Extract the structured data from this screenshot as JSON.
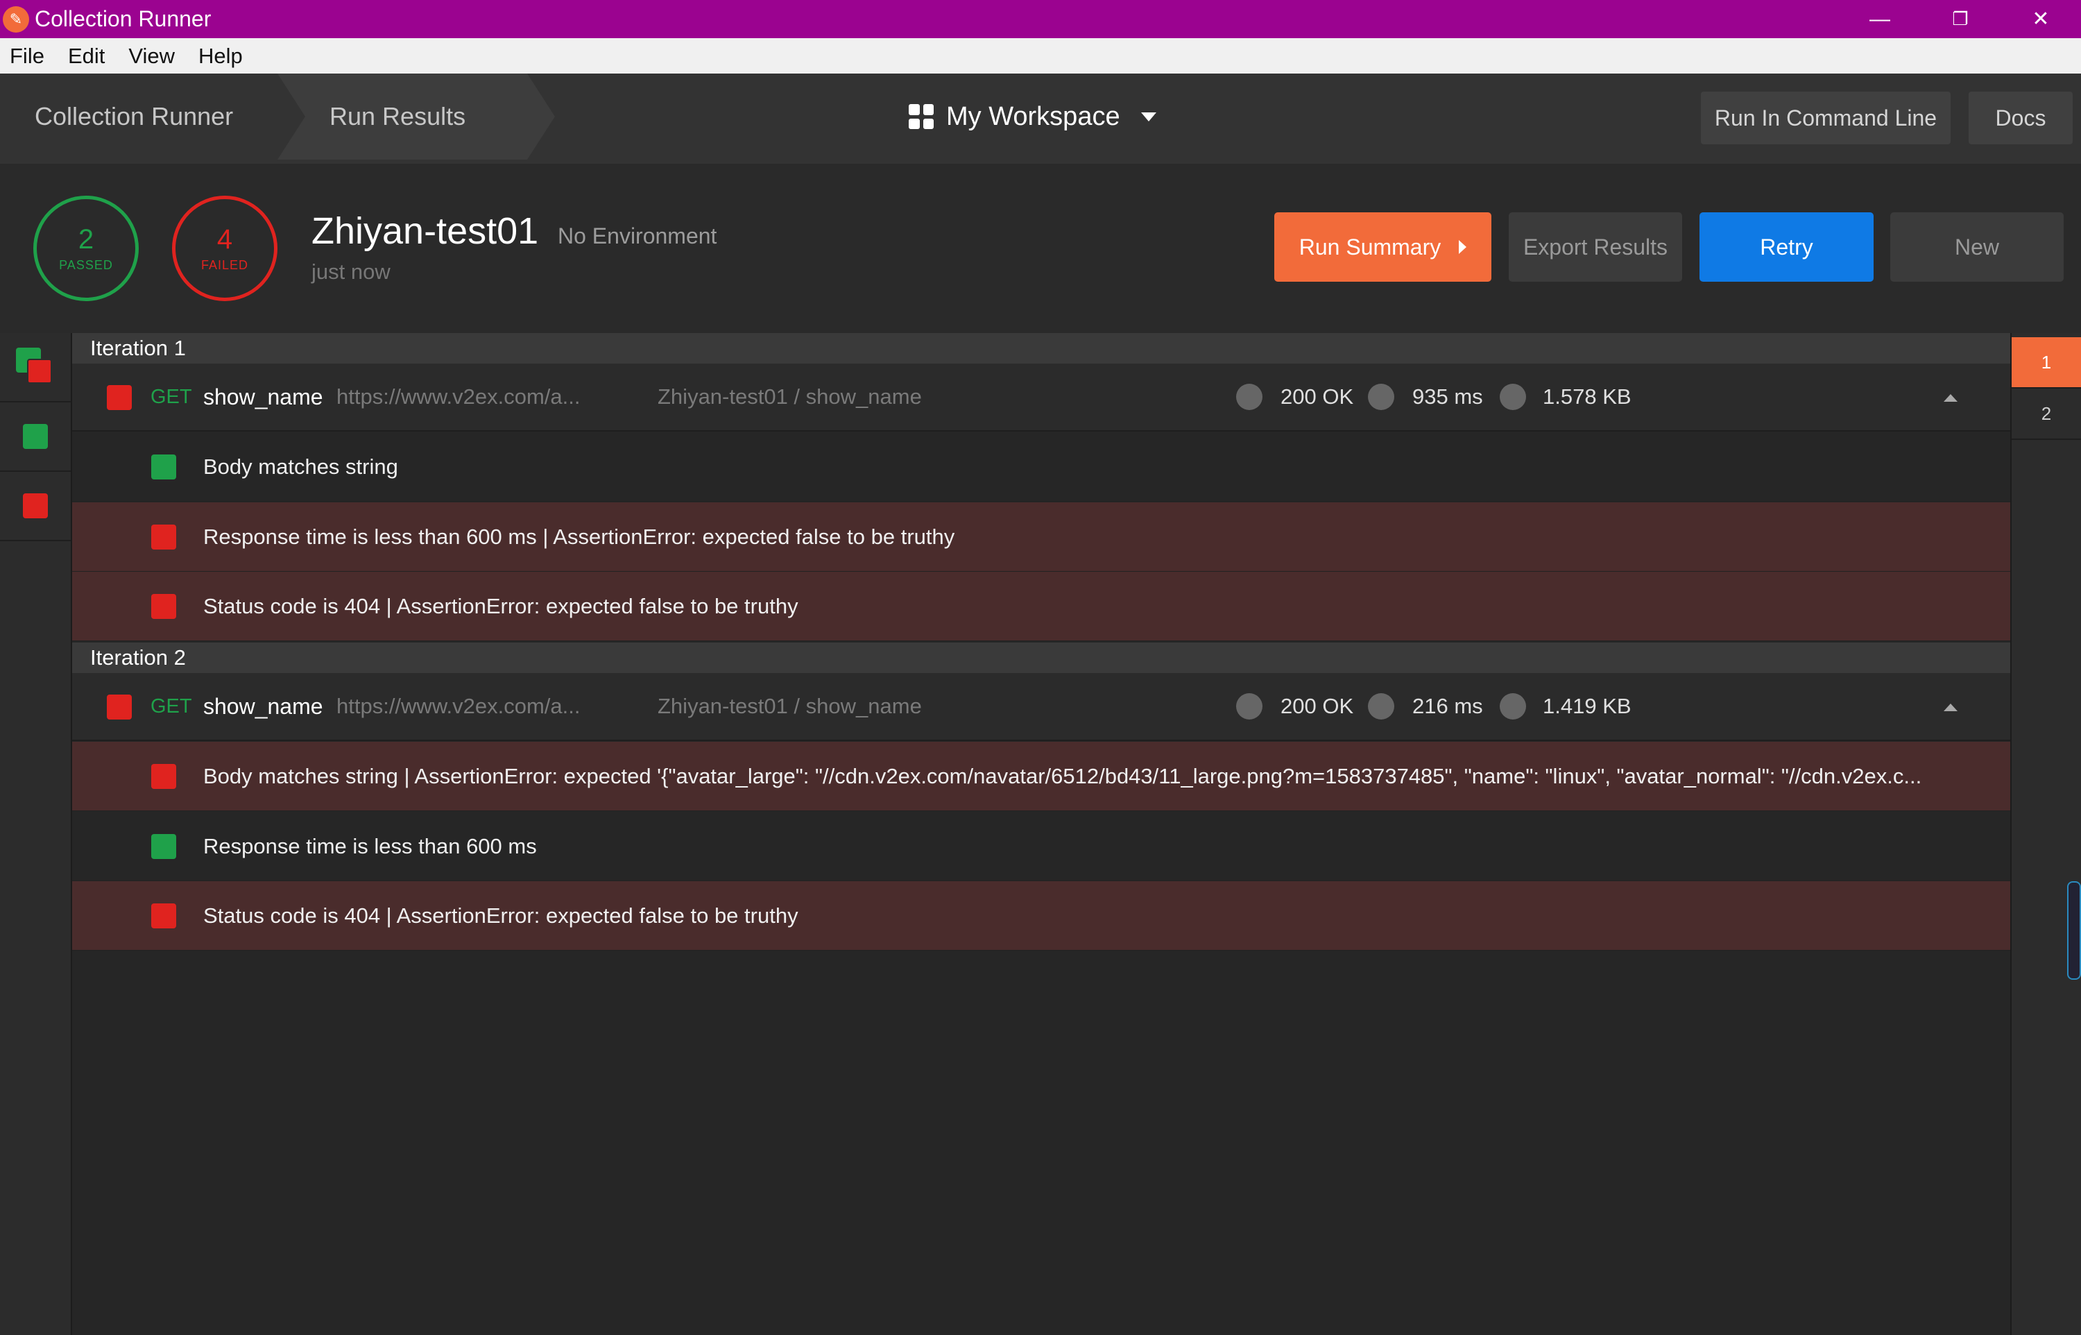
{
  "window": {
    "title": "Collection Runner",
    "controls": {
      "minimize": "—",
      "restore": "❐",
      "close": "✕"
    }
  },
  "menu": [
    "File",
    "Edit",
    "View",
    "Help"
  ],
  "nav": {
    "breadcrumb_1": "Collection Runner",
    "breadcrumb_2": "Run Results",
    "workspace": "My Workspace",
    "run_cli": "Run In Command Line",
    "docs": "Docs"
  },
  "summary": {
    "passed_count": "2",
    "passed_label": "PASSED",
    "failed_count": "4",
    "failed_label": "FAILED",
    "collection": "Zhiyan-test01",
    "environment": "No Environment",
    "time": "just now",
    "buttons": {
      "run_summary": "Run Summary",
      "export": "Export Results",
      "retry": "Retry",
      "new": "New"
    }
  },
  "colors": {
    "titlebar": "#9b0390",
    "pass": "#1fa14a",
    "fail": "#e0231f",
    "accent": "#f26b3a",
    "retry": "#0f7ae5"
  },
  "iterations": [
    {
      "label": "Iteration 1",
      "request": {
        "method": "GET",
        "name": "show_name",
        "url": "https://www.v2ex.com/a...",
        "path": "Zhiyan-test01 / show_name",
        "status": "200 OK",
        "time": "935 ms",
        "size": "1.578 KB"
      },
      "tests": [
        {
          "text": "Body matches string",
          "result": "pass"
        },
        {
          "text": "Response time is less than 600 ms | AssertionError: expected false to be truthy",
          "result": "fail"
        },
        {
          "text": "Status code is 404 | AssertionError: expected false to be truthy",
          "result": "fail"
        }
      ]
    },
    {
      "label": "Iteration 2",
      "request": {
        "method": "GET",
        "name": "show_name",
        "url": "https://www.v2ex.com/a...",
        "path": "Zhiyan-test01 / show_name",
        "status": "200 OK",
        "time": "216 ms",
        "size": "1.419 KB"
      },
      "tests": [
        {
          "text": "Body matches string | AssertionError: expected '{\"avatar_large\": \"//cdn.v2ex.com/navatar/6512/bd43/11_large.png?m=1583737485\", \"name\": \"linux\", \"avatar_normal\": \"//cdn.v2ex.c...",
          "result": "fail"
        },
        {
          "text": "Response time is less than 600 ms",
          "result": "pass"
        },
        {
          "text": "Status code is 404 | AssertionError: expected false to be truthy",
          "result": "fail"
        }
      ]
    }
  ],
  "iteration_tabs": [
    "1",
    "2"
  ]
}
